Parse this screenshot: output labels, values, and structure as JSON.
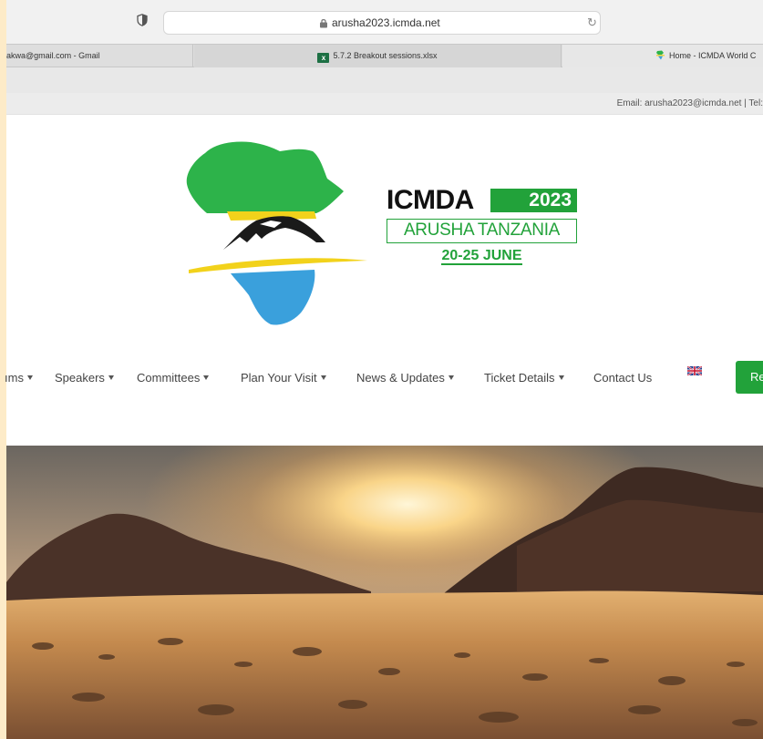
{
  "browser": {
    "url": "arusha2023.icmda.net",
    "tabs": [
      {
        "label": "akwa@gmail.com - Gmail",
        "icon": "none"
      },
      {
        "label": "5.7.2 Breakout sessions.xlsx",
        "icon": "excel-icon"
      },
      {
        "label": "Home - ICMDA World C",
        "icon": "icmda-favicon"
      }
    ]
  },
  "topbar": {
    "contact": "Email: arusha2023@icmda.net | Tel:"
  },
  "logo": {
    "name": "ICMDA",
    "year": "2023",
    "place": "ARUSHA TANZANIA",
    "dates": "20-25 JUNE"
  },
  "nav": {
    "items": [
      {
        "label": "ıms",
        "dropdown": true
      },
      {
        "label": "Speakers",
        "dropdown": true
      },
      {
        "label": "Committees",
        "dropdown": true
      },
      {
        "label": "Plan Your Visit",
        "dropdown": true
      },
      {
        "label": "News & Updates",
        "dropdown": true
      },
      {
        "label": "Ticket Details",
        "dropdown": true
      },
      {
        "label": "Contact Us",
        "dropdown": false
      }
    ],
    "language_icon": "uk-flag-icon",
    "register_label": "Re"
  },
  "hero": {
    "image": "savanna-sunset-mountains"
  },
  "colors": {
    "brand_green": "#22a23a",
    "africa_green": "#2db34a",
    "yellow": "#f2d21b",
    "water_blue": "#3aa0dc"
  }
}
